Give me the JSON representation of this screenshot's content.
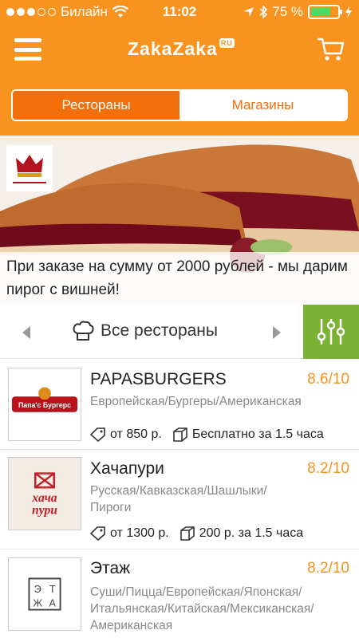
{
  "status": {
    "carrier": "Билайн",
    "time": "11:02",
    "battery": "75 %"
  },
  "header": {
    "logo": "ZakaZaka",
    "logo_suffix": "RU"
  },
  "tabs": [
    {
      "label": "Рестораны",
      "active": true
    },
    {
      "label": "Магазины",
      "active": false
    }
  ],
  "banner": {
    "caption": "При заказе на сумму от 2000 рублей - мы дарим пирог с вишней!"
  },
  "filter": {
    "label": "Все рестораны"
  },
  "restaurants": [
    {
      "name": "PAPASBURGERS",
      "rating": "8.6/10",
      "cuisine": "Европейская/Бургеры/Американская",
      "min_order": "от 850 р.",
      "delivery": "Бесплатно за 1.5 часа",
      "logo_text": "Папа'с Бургерс"
    },
    {
      "name": "Хачапури",
      "rating": "8.2/10",
      "cuisine": "Русская/Кавказская/Шашлыки/Пироги",
      "min_order": "от 1300 р.",
      "delivery": "200 р. за 1.5 часа",
      "logo_text": "хача пури"
    },
    {
      "name": "Этаж",
      "rating": "8.2/10",
      "cuisine": "Суши/Пицца/Европейская/Японская/Итальянская/Китайская/Мексиканская/Американская",
      "min_order": "",
      "delivery": "",
      "logo_text": "ЭТАЖ"
    }
  ],
  "colors": {
    "accent": "#f7931e",
    "tab_active": "#f26f0c",
    "filter_button": "#7bb236",
    "battery": "#4cd964"
  }
}
